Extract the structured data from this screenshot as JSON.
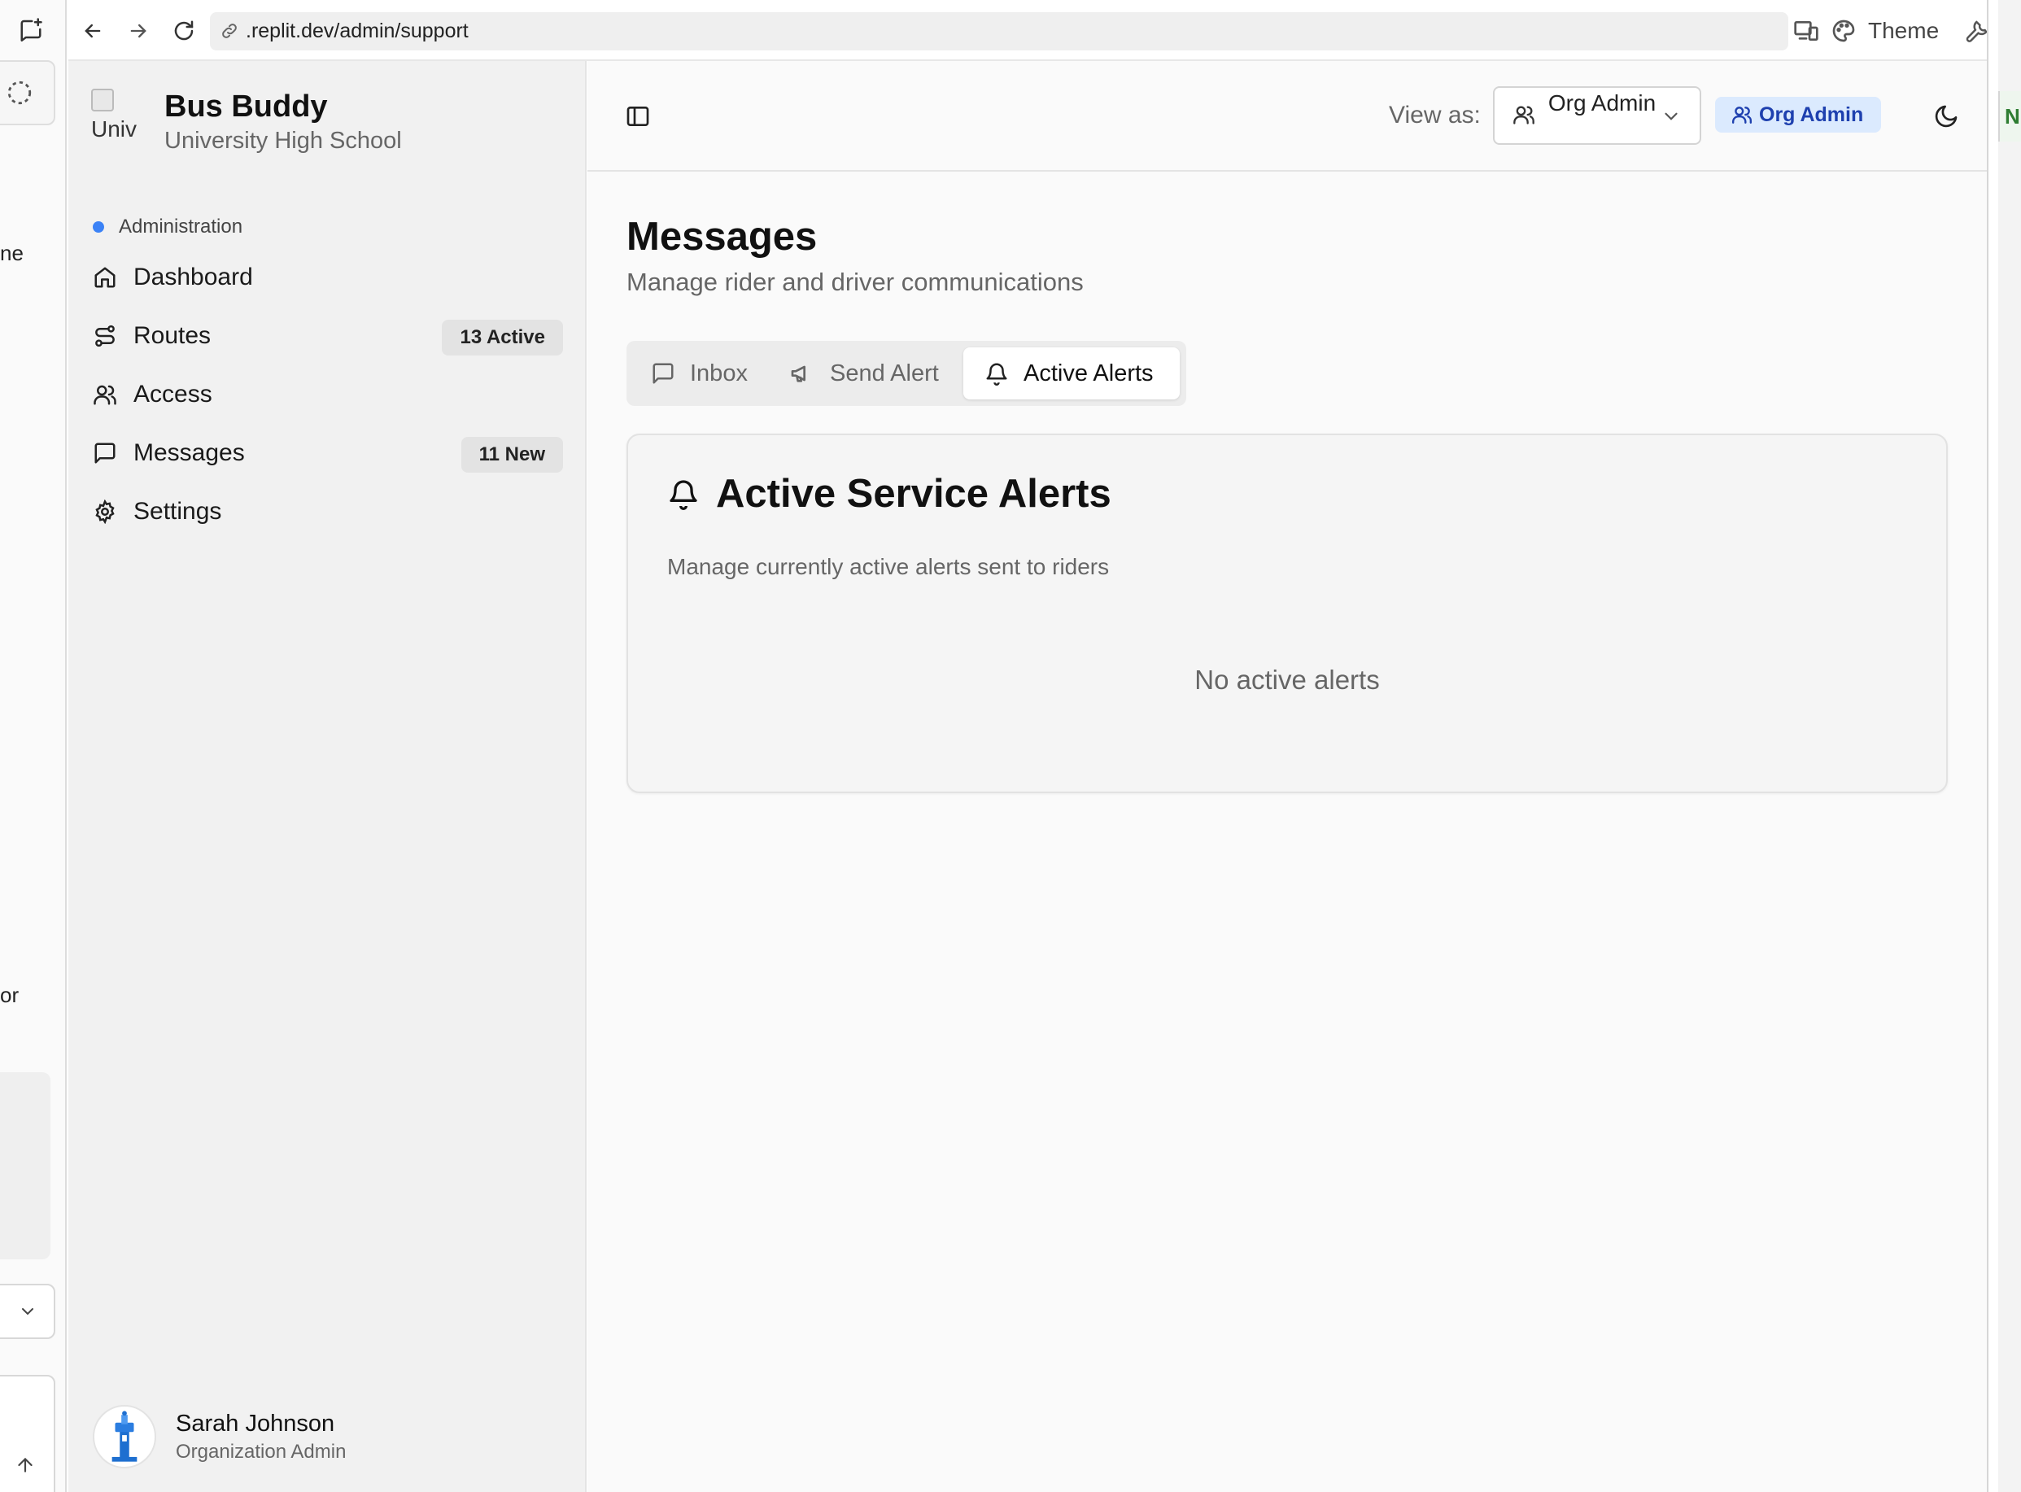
{
  "left_strip": {
    "text_1": "ne",
    "text_2": "or"
  },
  "browser": {
    "url": ".replit.dev/admin/support",
    "theme_label": "Theme"
  },
  "sidebar": {
    "brand_title": "Bus Buddy",
    "brand_subtitle": "University High School",
    "logo_alt": "Univ",
    "section_label": "Administration",
    "items": [
      {
        "label": "Dashboard",
        "icon": "home-icon",
        "badge": ""
      },
      {
        "label": "Routes",
        "icon": "route-icon",
        "badge": "13 Active"
      },
      {
        "label": "Access",
        "icon": "users-icon",
        "badge": ""
      },
      {
        "label": "Messages",
        "icon": "message-square-icon",
        "badge": "11 New"
      },
      {
        "label": "Settings",
        "icon": "settings-gear-icon",
        "badge": ""
      }
    ],
    "user": {
      "name": "Sarah Johnson",
      "role": "Organization Admin"
    }
  },
  "topbar": {
    "view_as_label": "View as:",
    "view_as_value": "Org Admin",
    "role_chip": "Org Admin"
  },
  "main": {
    "title": "Messages",
    "subtitle": "Manage rider and driver communications",
    "tabs": [
      {
        "label": "Inbox",
        "icon": "message-square-icon",
        "active": false
      },
      {
        "label": "Send Alert",
        "icon": "megaphone-icon",
        "active": false
      },
      {
        "label": "Active Alerts",
        "icon": "bell-icon",
        "active": true
      }
    ],
    "card": {
      "title": "Active Service Alerts",
      "description": "Manage currently active alerts sent to riders",
      "empty_text": "No active alerts"
    }
  },
  "right_strip": {
    "tag_text": "NE"
  },
  "colors": {
    "accent_blue": "#3b82f6",
    "role_chip_bg": "#dbeafe",
    "role_chip_text": "#1e40af"
  }
}
